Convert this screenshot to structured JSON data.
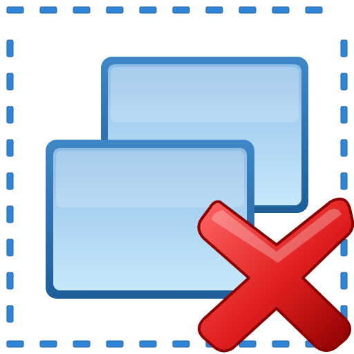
{
  "icon": {
    "semantic": "remove-selected-windows-icon",
    "parts": [
      "dashed-selection-frame",
      "window-back",
      "window-front",
      "delete-x-mark"
    ]
  },
  "colors": {
    "frame_dash": "#2f86d6",
    "frame_dash_outline": "#1f5f9e",
    "window_border": "#1d5e98",
    "window_border_light": "#3f87c7",
    "window_fill_top": "#8dbde7",
    "window_fill_mid": "#a9d2f2",
    "window_fill_bottom": "#c7e8fb",
    "x_fill": "#e01e1e",
    "x_fill_light": "#ff6666",
    "x_outline": "#8a0000"
  }
}
